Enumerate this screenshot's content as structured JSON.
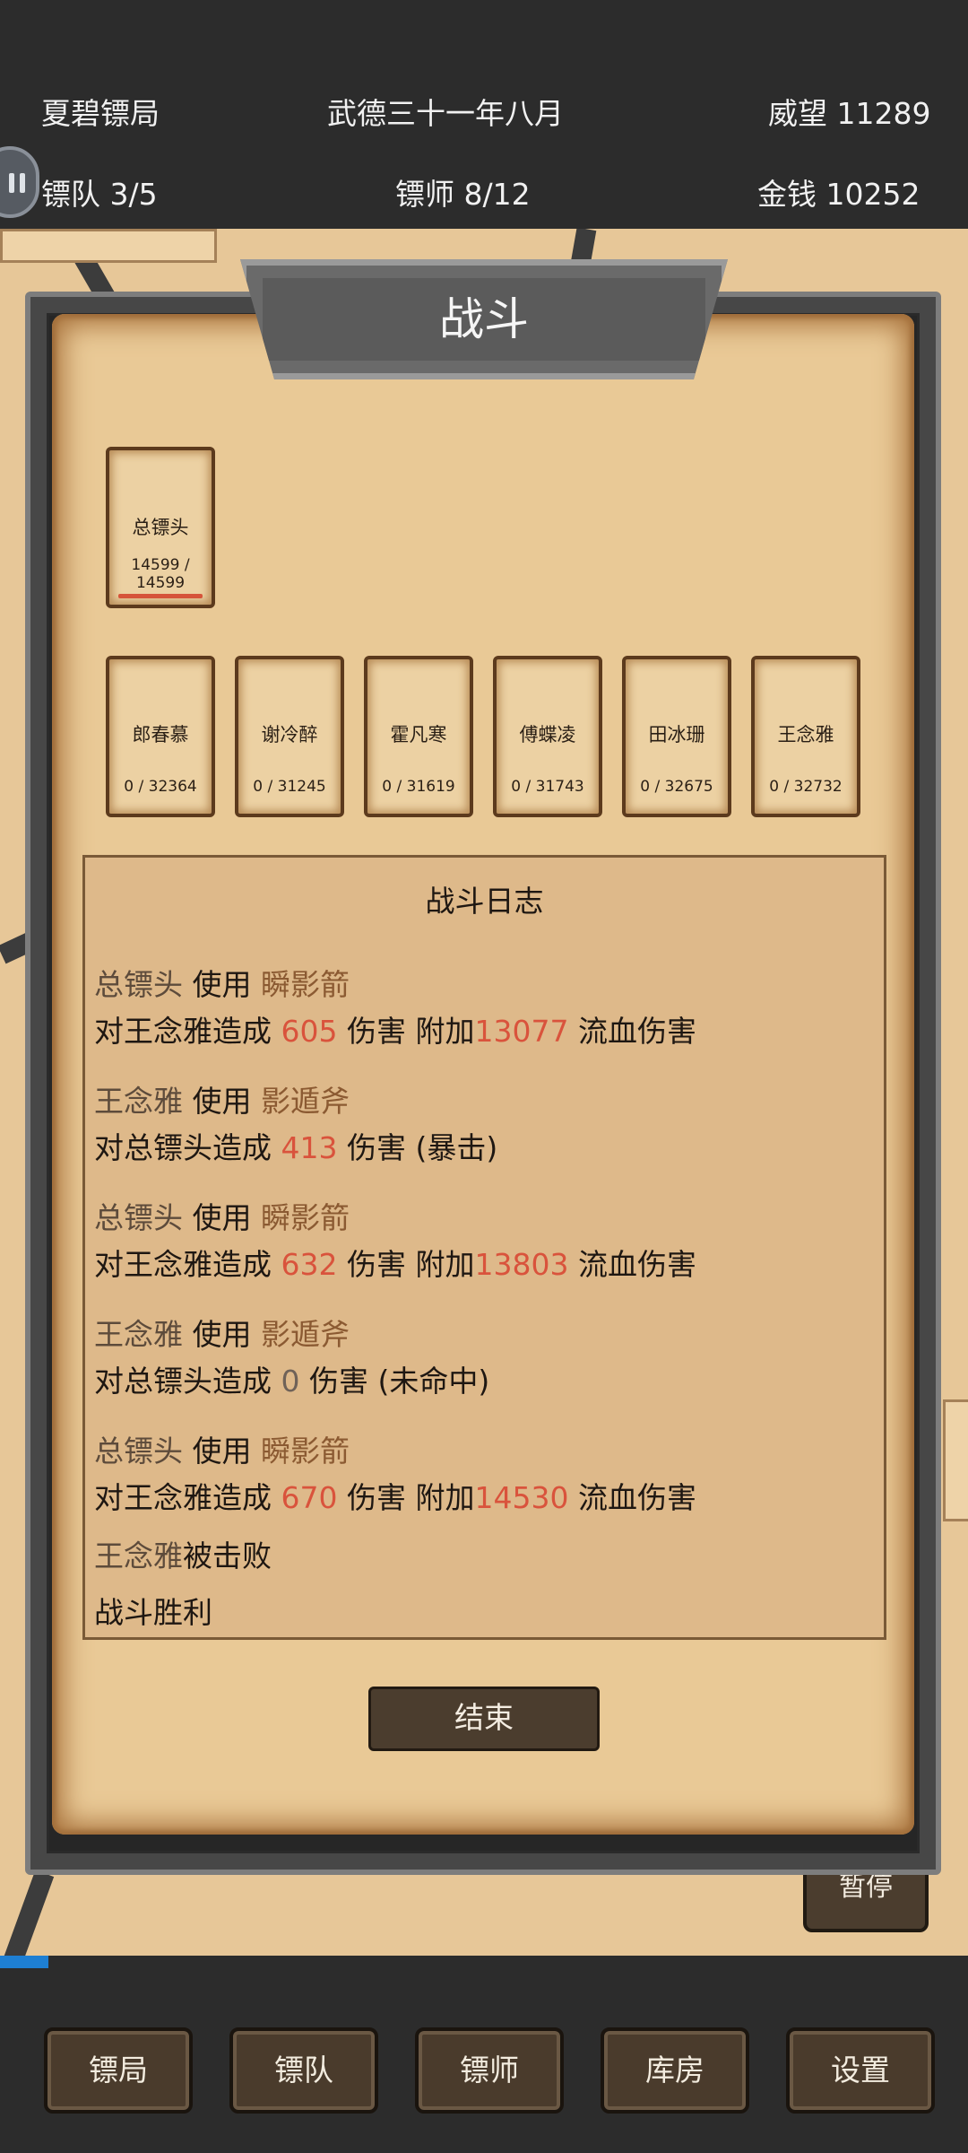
{
  "header": {
    "agency_name": "夏碧镖局",
    "date": "武德三十一年八月",
    "prestige": "威望 11289",
    "team": "镖队 3/5",
    "escorts": "镖师 8/12",
    "money": "金钱  10252"
  },
  "dialog": {
    "title": "战斗",
    "boss": {
      "name": "总镖头",
      "hp": "14599 / 14599"
    },
    "enemies": [
      {
        "name": "郎春慕",
        "hp": "0 / 32364"
      },
      {
        "name": "谢冷醉",
        "hp": "0 / 31245"
      },
      {
        "name": "霍凡寒",
        "hp": "0 / 31619"
      },
      {
        "name": "傅蝶凌",
        "hp": "0 / 31743"
      },
      {
        "name": "田冰珊",
        "hp": "0 / 32675"
      },
      {
        "name": "王念雅",
        "hp": "0 / 32732"
      }
    ],
    "log": {
      "title": "战斗日志",
      "entries": [
        {
          "actor": "总镖头",
          "use": " 使用 ",
          "skill": "瞬影箭",
          "pre": "对王念雅造成 ",
          "damage": "605",
          "mid": " 伤害 附加",
          "bleed": "13077",
          "post": " 流血伤害"
        },
        {
          "actor": "王念雅",
          "use": " 使用 ",
          "skill": "影遁斧",
          "pre": "对总镖头造成 ",
          "damage": "413",
          "post": " 伤害 (暴击)"
        },
        {
          "actor": "总镖头",
          "use": " 使用 ",
          "skill": "瞬影箭",
          "pre": "对王念雅造成 ",
          "damage": "632",
          "mid": " 伤害 附加",
          "bleed": "13803",
          "post": " 流血伤害"
        },
        {
          "actor": "王念雅",
          "use": " 使用 ",
          "skill": "影遁斧",
          "pre": "对总镖头造成 ",
          "damage": "0",
          "post": " 伤害 (未命中)"
        },
        {
          "actor": "总镖头",
          "use": " 使用 ",
          "skill": "瞬影箭",
          "pre": "对王念雅造成 ",
          "damage": "670",
          "mid": " 伤害 附加",
          "bleed": "14530",
          "post": " 流血伤害"
        }
      ],
      "defeat_actor": "王念雅",
      "defeat_text": "被击败",
      "victory": "战斗胜利"
    },
    "end_button": "结束"
  },
  "pause_button": "暂停",
  "progress": 0.05,
  "nav": [
    "镖局",
    "镖队",
    "镖师",
    "库房",
    "设置"
  ]
}
